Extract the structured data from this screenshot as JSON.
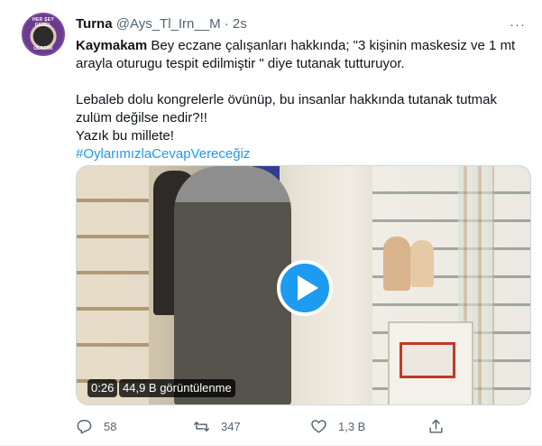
{
  "tweet": {
    "display_name": "Turna",
    "handle": "@Ays_Tl_Irn__M",
    "separator": "·",
    "time": "2s",
    "more_label": "···",
    "avatar_text_top": "HER ŞEY GÜZEL",
    "avatar_text_bottom": "OLACAK",
    "body": {
      "line1_bold": "Kaymakam",
      "line1_rest": " Bey eczane çalışanları hakkında; \"3 kişinin maskesiz ve 1 mt arayla oturugu tespit edilmiştir \" diye tutanak tutturuyor.",
      "line2": "Lebaleb dolu kongrelerle övünüp, bu insanlar hakkında tutanak tutmak zulüm değilse nedir?!!",
      "line3": "Yazık bu millete!",
      "hashtag": "#OylarımızlaCevapVereceğiz"
    },
    "media": {
      "duration": "0:26",
      "views": "44,9 B görüntülenme"
    },
    "actions": {
      "reply_count": "58",
      "retweet_count": "347",
      "like_count": "1,3 B"
    },
    "colors": {
      "accent": "#1d9bf0",
      "secondary_text": "#536471",
      "primary_text": "#0f1419"
    }
  }
}
